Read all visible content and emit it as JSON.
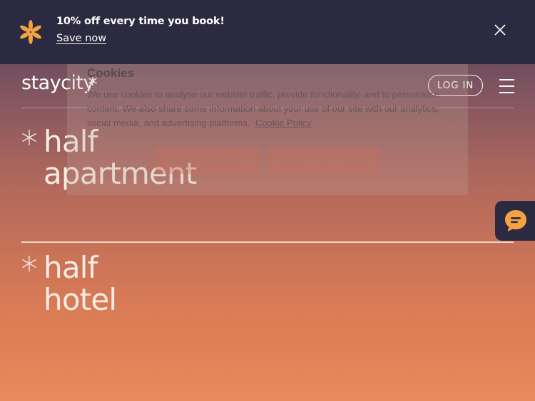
{
  "banner": {
    "promo_text": "10% off every time you book!",
    "save_link": "Save now",
    "icons": {
      "star": "asterisk-star-icon",
      "close": "close-icon"
    },
    "colors": {
      "background": "#2b2a40",
      "star": "#f4a340"
    }
  },
  "header": {
    "logo": "staycity",
    "login_label": "LOG IN",
    "icons": {
      "menu": "hamburger-menu-icon"
    }
  },
  "cookie_dialog": {
    "title": "Cookies",
    "body": "We use cookies to analyse our website traffic, provide functionality, and to personalise content. We also share some information about your use of our site with our analytics, social media, and advertising platforms.",
    "policy_link": "Cookie Policy",
    "settings_button": "COOKIES SETTINGS",
    "accept_button": "ACCEPT ALL COOKIES"
  },
  "sections": [
    {
      "line1": "half",
      "line2": "apartment"
    },
    {
      "line1": "half",
      "line2": "hotel"
    }
  ],
  "chat": {
    "icon": "chat-bubble-icon",
    "color": "#f4a340"
  }
}
